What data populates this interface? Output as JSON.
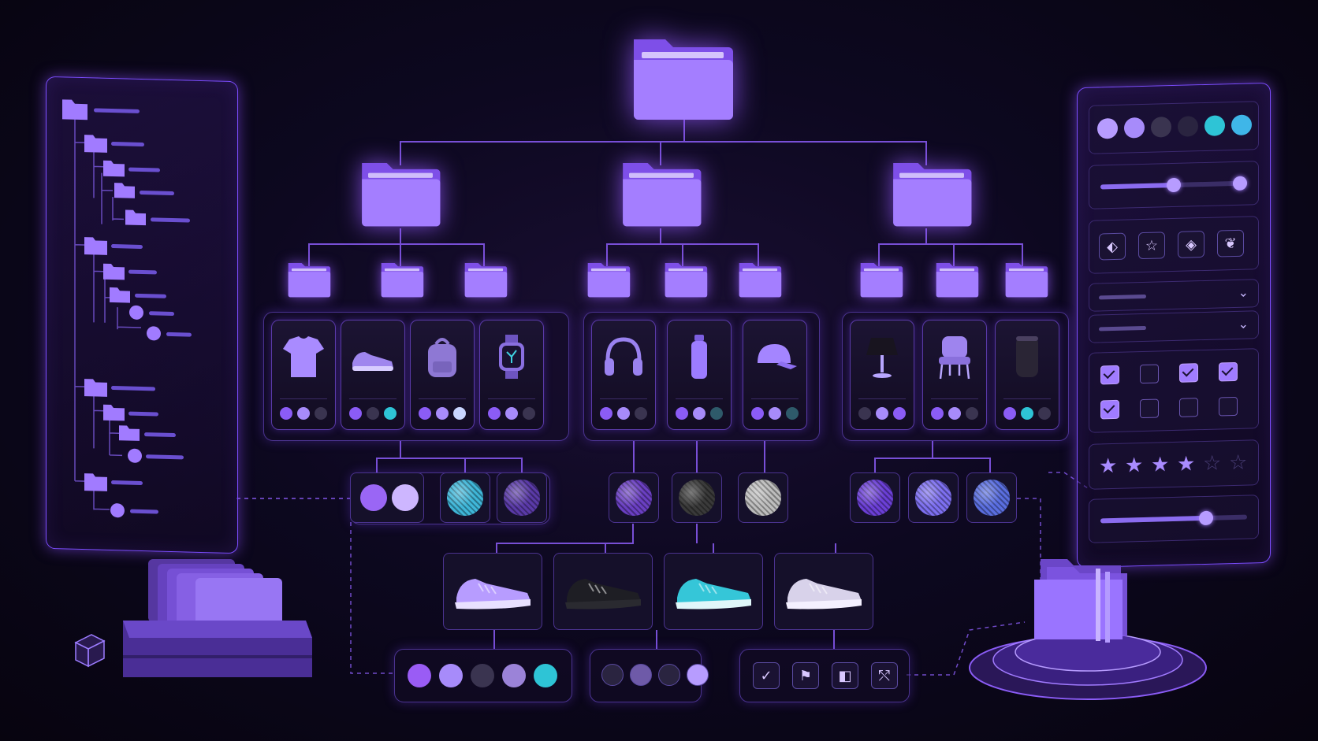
{
  "colors": {
    "accent": "#8b5cf6",
    "accent_light": "#b79cff",
    "cyan": "#2ec4d6",
    "dark_dot": "#3a3450",
    "background": "#0a0614"
  },
  "left_tree": {
    "icons": [
      "folder-icon"
    ]
  },
  "hierarchy": {
    "root_icon": "folder-icon",
    "categories": [
      {
        "icon": "folder-icon",
        "subfolders": 3
      },
      {
        "icon": "folder-icon",
        "subfolders": 3
      },
      {
        "icon": "folder-icon",
        "subfolders": 3
      }
    ]
  },
  "products": [
    {
      "icon": "tshirt-icon",
      "swatches": [
        "#8b5cf6",
        "#a78bfa",
        "#3a3450"
      ]
    },
    {
      "icon": "sneaker-icon",
      "swatches": [
        "#8b5cf6",
        "#3a3450",
        "#2ec4d6"
      ]
    },
    {
      "icon": "backpack-icon",
      "swatches": [
        "#8b5cf6",
        "#a78bfa",
        "#c9d6ff"
      ]
    },
    {
      "icon": "smartwatch-icon",
      "swatches": [
        "#8b5cf6",
        "#a78bfa",
        "#3a3450"
      ]
    },
    {
      "icon": "headphones-icon",
      "swatches": [
        "#8b5cf6",
        "#a78bfa",
        "#3a3450"
      ]
    },
    {
      "icon": "water-bottle-icon",
      "swatches": [
        "#8b5cf6",
        "#a78bfa",
        "#2e5a6a"
      ]
    },
    {
      "icon": "cap-icon",
      "swatches": [
        "#8b5cf6",
        "#a78bfa",
        "#2e5a6a"
      ]
    },
    {
      "icon": "lamp-icon",
      "swatches": [
        "#3a3450",
        "#a78bfa",
        "#8b5cf6"
      ]
    },
    {
      "icon": "chair-icon",
      "swatches": [
        "#8b5cf6",
        "#a78bfa",
        "#3a3450"
      ]
    },
    {
      "icon": "speaker-icon",
      "swatches": [
        "#8b5cf6",
        "#2ec4d6",
        "#3a3450"
      ]
    }
  ],
  "materials": {
    "group1": [
      {
        "type": "color-pair",
        "colors": [
          "#9a66f5",
          "#cdb6ff"
        ]
      },
      {
        "type": "texture",
        "color": "#3fb6d8"
      },
      {
        "type": "texture",
        "color": "#5a3aa8"
      }
    ],
    "group2": [
      {
        "type": "texture",
        "color": "#6a3fc2"
      },
      {
        "type": "texture",
        "color": "#3a3a3a"
      },
      {
        "type": "texture",
        "color": "#bdbdbd"
      }
    ],
    "group3": [
      {
        "type": "texture",
        "color": "#6b3fd6"
      },
      {
        "type": "texture",
        "color": "#7d6ff0"
      },
      {
        "type": "texture",
        "color": "#5a6ee0"
      }
    ]
  },
  "shoe_variants": [
    {
      "color": "#b79cff",
      "sole": "#e8e0ff"
    },
    {
      "color": "#1e1e24",
      "sole": "#2a2a30"
    },
    {
      "color": "#35c6d8",
      "sole": "#e0f7fa"
    },
    {
      "color": "#d8d2ea",
      "sole": "#f4f0ff"
    }
  ],
  "bottom_options": {
    "swatches": [
      "#9a5cf5",
      "#a78bfa",
      "#3a3450",
      "#9b83d8",
      "#2ec4d6"
    ],
    "radios": [
      "#2a2440",
      "#6e5aa8",
      "#2a2440",
      "#b79cff"
    ],
    "icons": [
      "check-icon",
      "flag-icon",
      "toggle-icon",
      "share-icon"
    ]
  },
  "right_panel": {
    "swatches": [
      "#b79cff",
      "#a78bfa",
      "#3a3450",
      "#2a2440",
      "#2ec4d6",
      "#3fb6e8"
    ],
    "slider1_level": 0.5,
    "slider2_level": 0.95,
    "icon_buttons": [
      "tag-icon",
      "star-icon",
      "diamond-icon",
      "leaf-icon"
    ],
    "dropdowns": 2,
    "checkboxes": [
      true,
      false,
      true,
      true,
      true,
      false,
      false,
      false
    ],
    "rating": 4,
    "rating_max": 6,
    "bottom_slider_level": 0.72
  }
}
